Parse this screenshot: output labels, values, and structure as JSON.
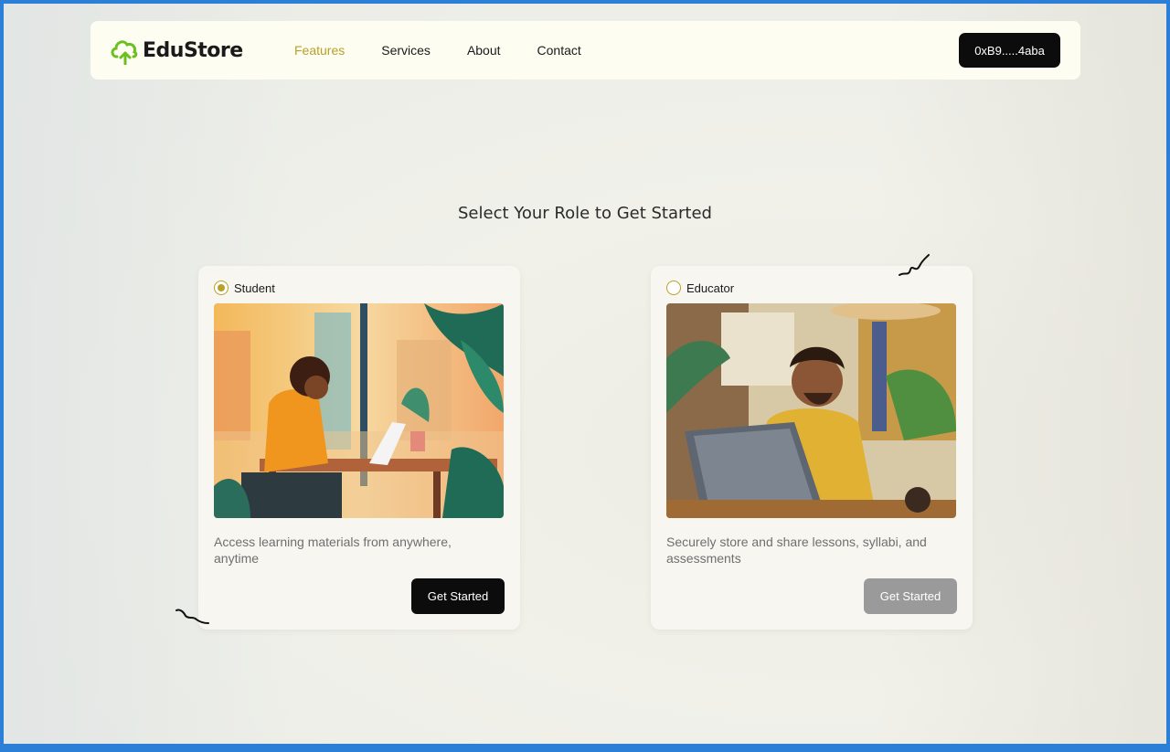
{
  "brand": {
    "name": "EduStore",
    "icon": "cloud-upload-icon",
    "accent": "#6bbf1e"
  },
  "nav": {
    "items": [
      {
        "label": "Features",
        "active": true
      },
      {
        "label": "Services",
        "active": false
      },
      {
        "label": "About",
        "active": false
      },
      {
        "label": "Contact",
        "active": false
      }
    ],
    "wallet_label": "0xB9.....4aba"
  },
  "main": {
    "heading": "Select Your Role to Get Started",
    "roles": [
      {
        "label": "Student",
        "selected": true,
        "image": "student-illustration",
        "description": "Access learning materials from anywhere, anytime",
        "button_label": "Get Started",
        "button_enabled": true
      },
      {
        "label": "Educator",
        "selected": false,
        "image": "educator-illustration",
        "description": "Securely store and share lessons, syllabi, and assessments",
        "button_label": "Get Started",
        "button_enabled": false
      }
    ]
  },
  "colors": {
    "accent_gold": "#b7a12a",
    "button_dark": "#0c0c0c",
    "button_disabled": "#9a9a9a",
    "frame_border": "#2b7fd6"
  }
}
